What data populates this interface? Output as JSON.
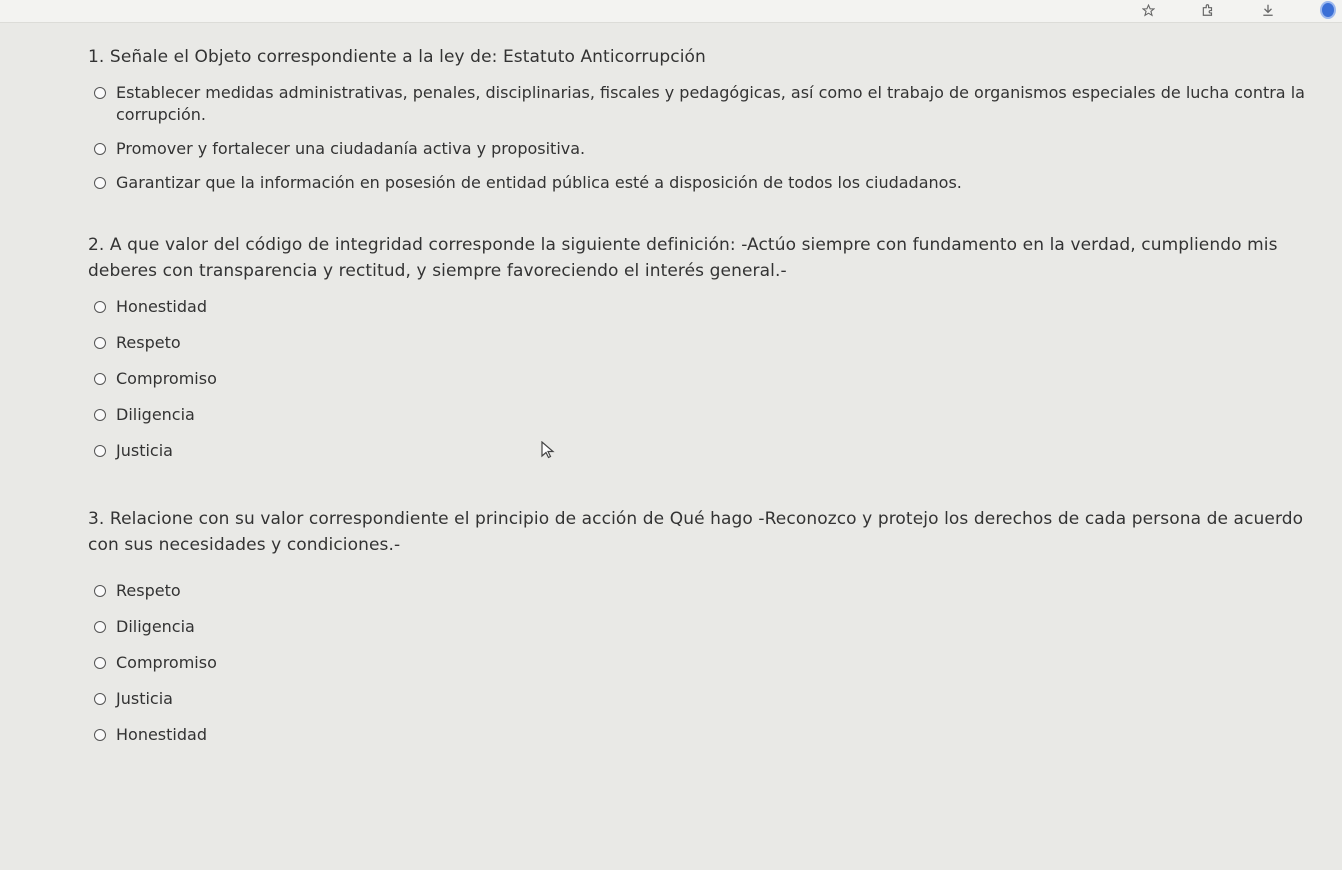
{
  "questions": [
    {
      "title": "1. Señale el Objeto correspondiente a la ley de: Estatuto Anticorrupción",
      "options": [
        "Establecer medidas administrativas, penales, disciplinarias, fiscales y pedagógicas, así como el trabajo de organismos especiales de lucha contra la corrupción.",
        "Promover y fortalecer una ciudadanía activa y propositiva.",
        "Garantizar que la información en posesión de entidad pública esté a disposición de todos los ciudadanos."
      ]
    },
    {
      "title": "2. A que valor del código de integridad corresponde la siguiente definición: -Actúo siempre con fundamento en la verdad, cumpliendo mis deberes con transparencia y rectitud, y siempre favoreciendo el interés general.-",
      "options": [
        "Honestidad",
        "Respeto",
        "Compromiso",
        "Diligencia",
        "Justicia"
      ]
    },
    {
      "title": "3. Relacione con su valor correspondiente el principio de acción de Qué hago -Reconozco y protejo los derechos de cada persona de acuerdo con sus necesidades y condiciones.-",
      "options": [
        "Respeto",
        "Diligencia",
        "Compromiso",
        "Justicia",
        "Honestidad"
      ]
    }
  ],
  "icons": {
    "toolbar": [
      "star-icon",
      "extensions-icon",
      "download-icon",
      "profile-icon"
    ],
    "cursor": "mouse-pointer-icon"
  },
  "colors": {
    "background": "#e9e9e6",
    "text": "#333333",
    "profile": "#3b6fd6"
  }
}
